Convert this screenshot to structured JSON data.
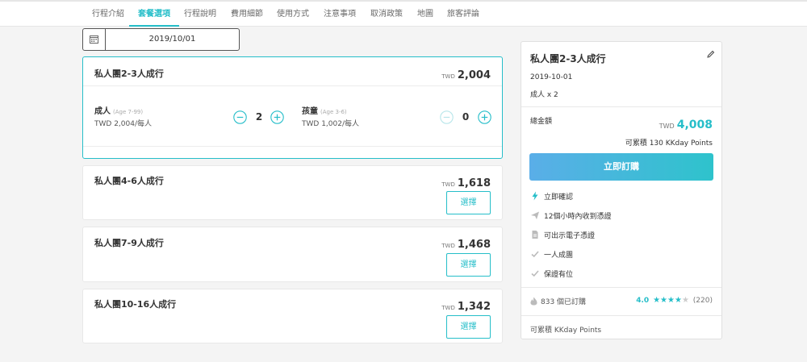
{
  "nav": {
    "tabs": [
      {
        "label": "行程介紹"
      },
      {
        "label": "套餐選項"
      },
      {
        "label": "行程說明"
      },
      {
        "label": "費用細節"
      },
      {
        "label": "使用方式"
      },
      {
        "label": "注意事項"
      },
      {
        "label": "取消政策"
      },
      {
        "label": "地圖"
      },
      {
        "label": "旅客評論"
      }
    ],
    "active_tab": "套餐選項"
  },
  "date_picker": {
    "value": "2019/10/01",
    "icon": "calendar-icon"
  },
  "packages": [
    {
      "name": "私人團2-3人成行",
      "currency": "TWD",
      "price": "2,004",
      "selected": true,
      "pax": {
        "adult": {
          "label": "成人",
          "age": "(Age 7-99)",
          "unit_price": "TWD 2,004/每人",
          "qty": "2"
        },
        "child": {
          "label": "孩童",
          "age": "(Age 3-6)",
          "unit_price": "TWD 1,002/每人",
          "qty": "0"
        }
      }
    },
    {
      "name": "私人團4-6人成行",
      "currency": "TWD",
      "price": "1,618",
      "select_label": "選擇"
    },
    {
      "name": "私人團7-9人成行",
      "currency": "TWD",
      "price": "1,468",
      "select_label": "選擇"
    },
    {
      "name": "私人團10-16人成行",
      "currency": "TWD",
      "price": "1,342",
      "select_label": "選擇"
    }
  ],
  "summary": {
    "title": "私人團2-3人成行",
    "date": "2019-10-01",
    "pax": "成人 x 2",
    "total_label": "總金額",
    "currency": "TWD",
    "total": "4,008",
    "points": "可累積 130 KKday Points",
    "buy_label": "立即訂購",
    "features": [
      {
        "icon": "lightning-icon",
        "text": "立即確認"
      },
      {
        "icon": "paper-plane-icon",
        "text": "12個小時內收到憑證"
      },
      {
        "icon": "document-icon",
        "text": "可出示電子憑證"
      },
      {
        "icon": "check-icon",
        "text": "一人成團"
      },
      {
        "icon": "check-icon",
        "text": "保證有位"
      }
    ],
    "orders": "833 個已訂購",
    "rating": "4.0",
    "stars": 4,
    "reviews": "(220)",
    "bottom_points": "可累積 KKday Points"
  },
  "colors": {
    "accent": "#26bec9",
    "gradient_start": "#5aaee8",
    "gradient_end": "#2ec3cc"
  }
}
